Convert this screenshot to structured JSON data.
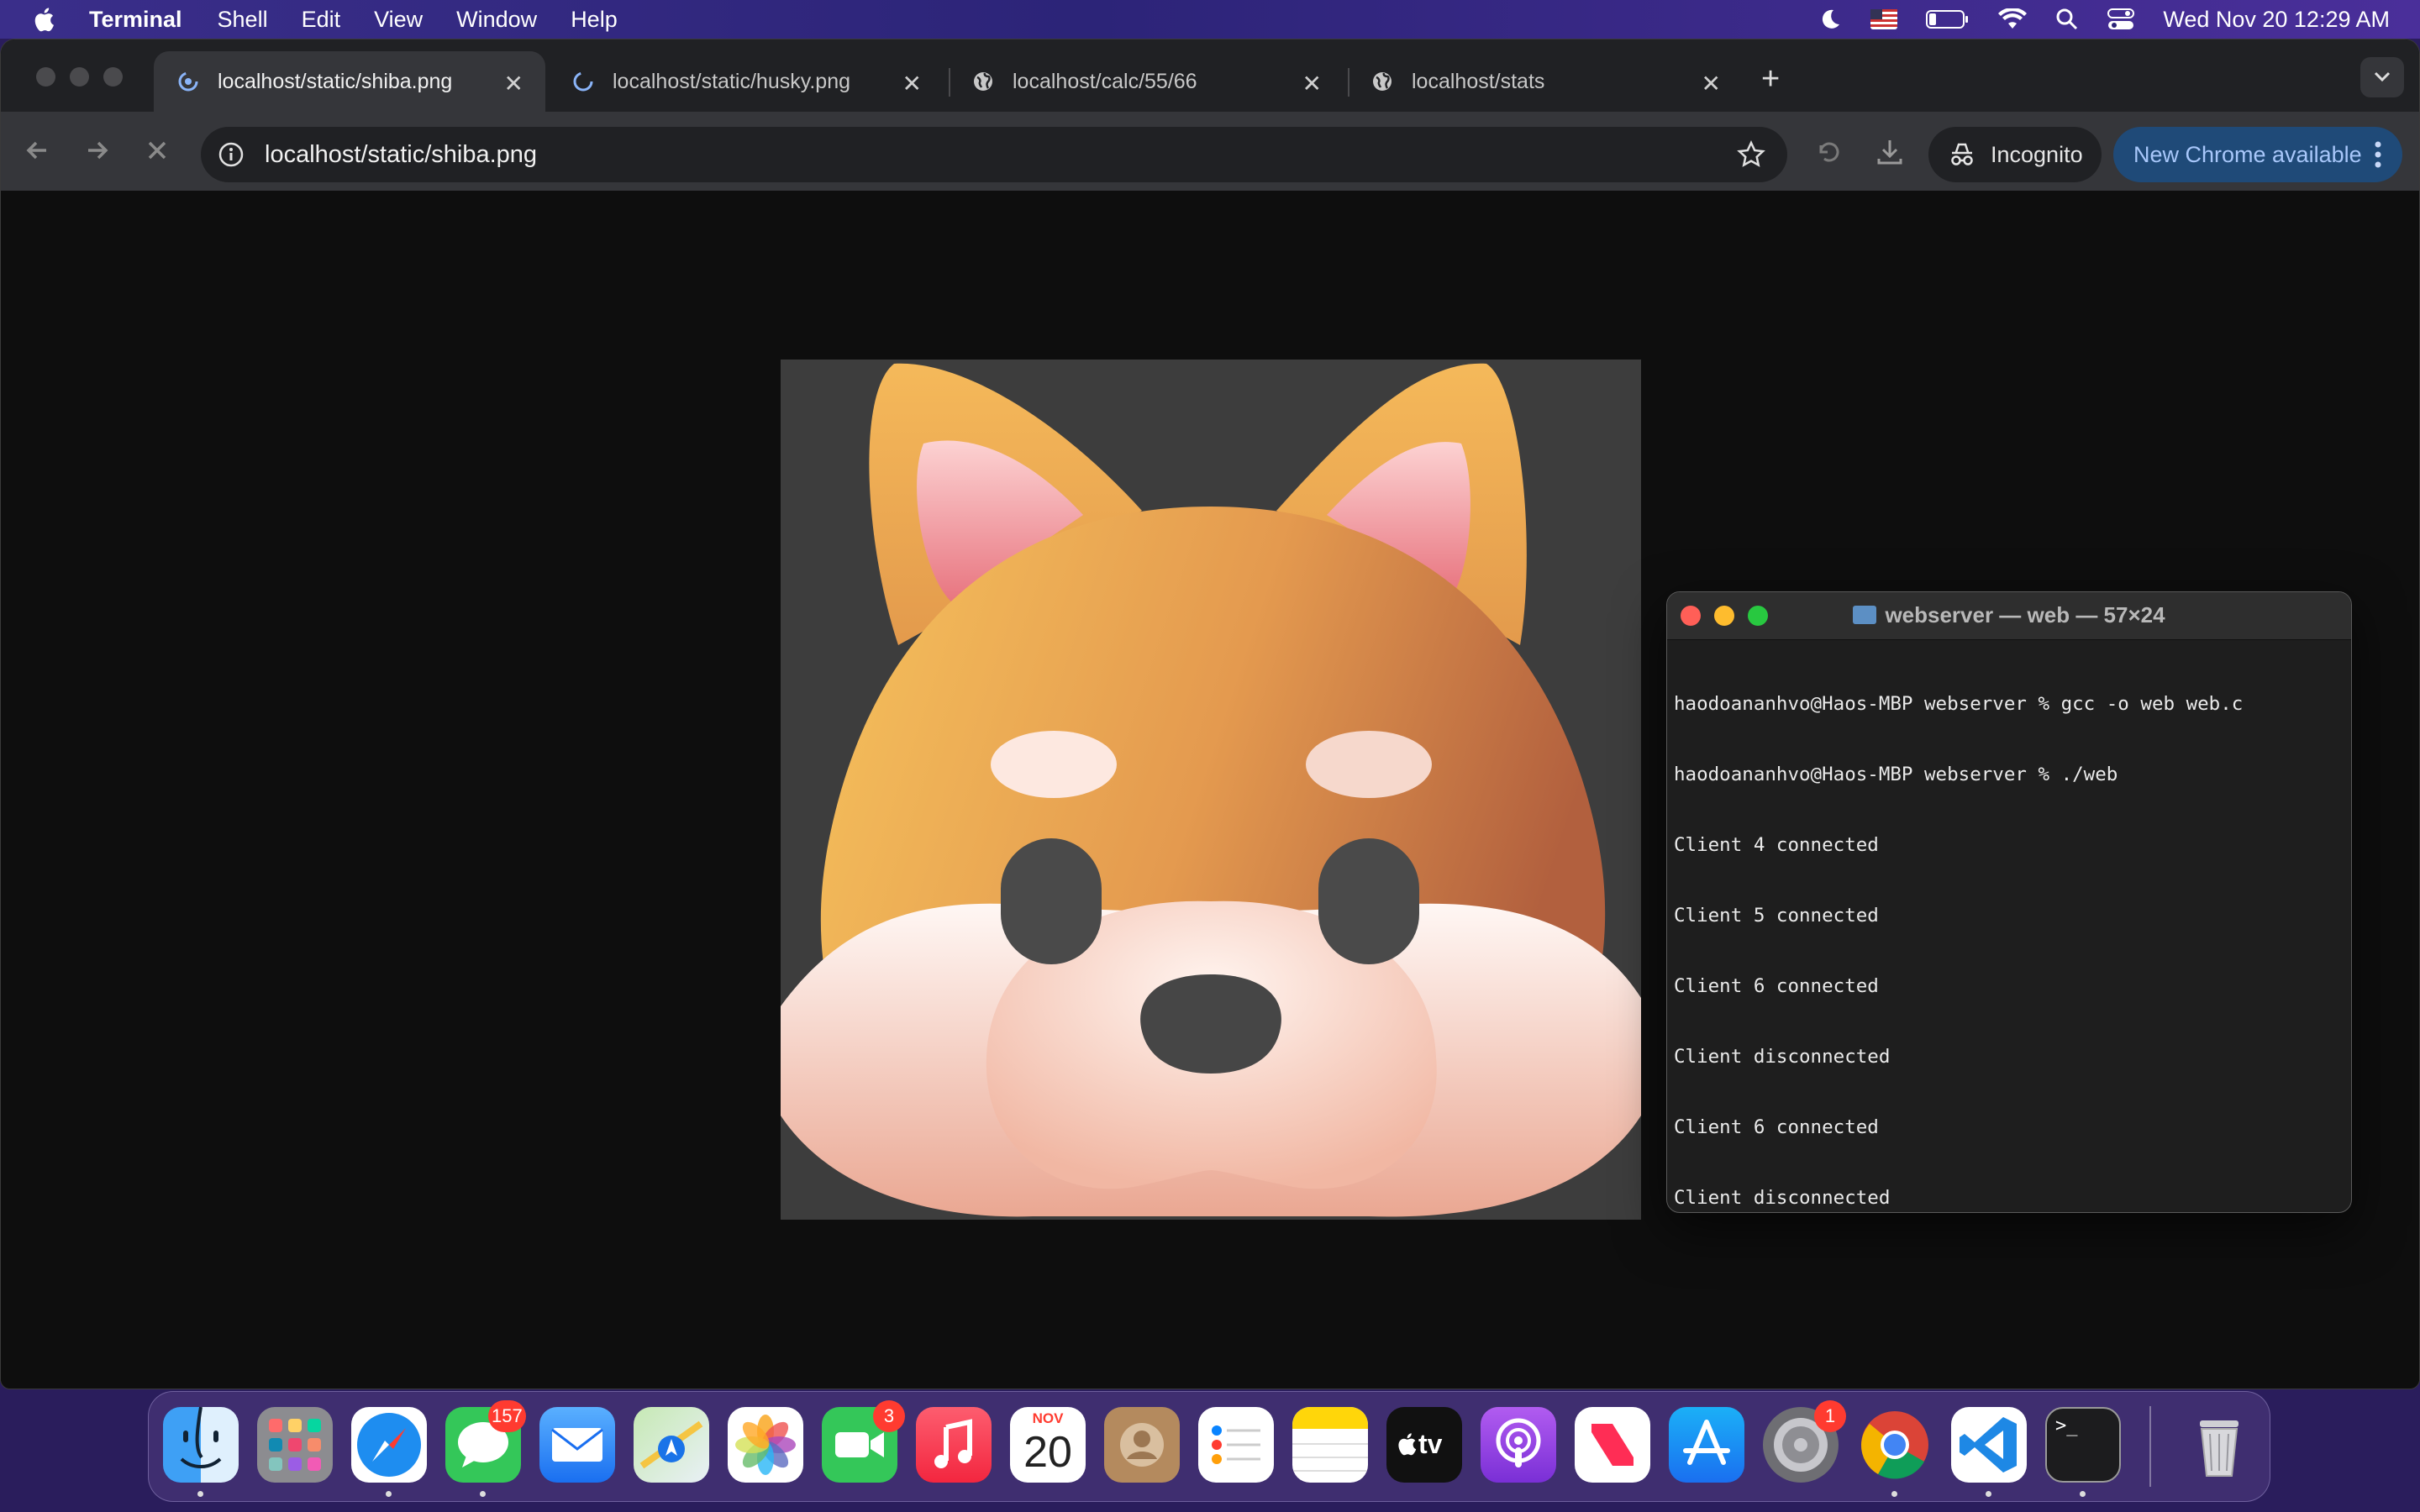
{
  "menubar": {
    "app_name": "Terminal",
    "menus": [
      "Shell",
      "Edit",
      "View",
      "Window",
      "Help"
    ],
    "clock": "Wed Nov 20  12:29 AM",
    "status_icons": [
      "moon-icon",
      "us-flag-icon",
      "battery-icon",
      "wifi-icon",
      "spotlight-search-icon",
      "control-center-icon"
    ]
  },
  "chrome": {
    "tabs": [
      {
        "title": "localhost/static/shiba.png",
        "active": true,
        "favicon": "loading-spinner-icon"
      },
      {
        "title": "localhost/static/husky.png",
        "active": false,
        "favicon": "loading-spinner-icon"
      },
      {
        "title": "localhost/calc/55/66",
        "active": false,
        "favicon": "globe-icon"
      },
      {
        "title": "localhost/stats",
        "active": false,
        "favicon": "globe-icon"
      }
    ],
    "address": "localhost/static/shiba.png",
    "incognito_label": "Incognito",
    "update_label": "New Chrome available",
    "page_image_alt": "shiba dog emoji image"
  },
  "terminal": {
    "title": "webserver — web — 57×24",
    "lines": [
      "haodoananhvo@Haos-MBP webserver % gcc -o web web.c",
      "haodoananhvo@Haos-MBP webserver % ./web",
      "Client 4 connected",
      "Client 5 connected",
      "Client 6 connected",
      "Client disconnected",
      "Client 6 connected",
      "Client disconnected"
    ]
  },
  "dock": {
    "apps": [
      {
        "name": "Finder",
        "icon": "finder-icon",
        "running": true
      },
      {
        "name": "Launchpad",
        "icon": "launchpad-icon",
        "running": false
      },
      {
        "name": "Safari",
        "icon": "safari-icon",
        "running": true
      },
      {
        "name": "Messages",
        "icon": "messages-icon",
        "running": true,
        "badge": "157"
      },
      {
        "name": "Mail",
        "icon": "mail-icon",
        "running": false
      },
      {
        "name": "Maps",
        "icon": "maps-icon",
        "running": false
      },
      {
        "name": "Photos",
        "icon": "photos-icon",
        "running": false
      },
      {
        "name": "FaceTime",
        "icon": "facetime-icon",
        "running": false,
        "badge": "3"
      },
      {
        "name": "Music",
        "icon": "music-icon",
        "running": false
      },
      {
        "name": "Calendar",
        "icon": "calendar-icon",
        "running": false,
        "month": "NOV",
        "day": "20"
      },
      {
        "name": "Contacts",
        "icon": "contacts-icon",
        "running": false
      },
      {
        "name": "Reminders",
        "icon": "reminders-icon",
        "running": false
      },
      {
        "name": "Notes",
        "icon": "notes-icon",
        "running": false
      },
      {
        "name": "TV",
        "icon": "apple-tv-icon",
        "running": false,
        "label": "tv"
      },
      {
        "name": "Podcasts",
        "icon": "podcasts-icon",
        "running": false
      },
      {
        "name": "News",
        "icon": "news-icon",
        "running": false
      },
      {
        "name": "App Store",
        "icon": "app-store-icon",
        "running": false
      },
      {
        "name": "System Settings",
        "icon": "system-settings-icon",
        "running": false,
        "badge": "1"
      },
      {
        "name": "Google Chrome",
        "icon": "chrome-icon",
        "running": true
      },
      {
        "name": "Visual Studio Code",
        "icon": "vscode-icon",
        "running": true
      },
      {
        "name": "Terminal",
        "icon": "terminal-icon",
        "running": true
      },
      {
        "name": "Trash",
        "icon": "trash-icon",
        "running": false
      }
    ]
  },
  "colors": {
    "menubar": "#2c2478",
    "chrome_frame": "#202124",
    "chrome_toolbar": "#35363a",
    "update_button": "#1f4a78",
    "page_bg": "#0e0e0e",
    "terminal_bg": "#1e1e1e"
  }
}
